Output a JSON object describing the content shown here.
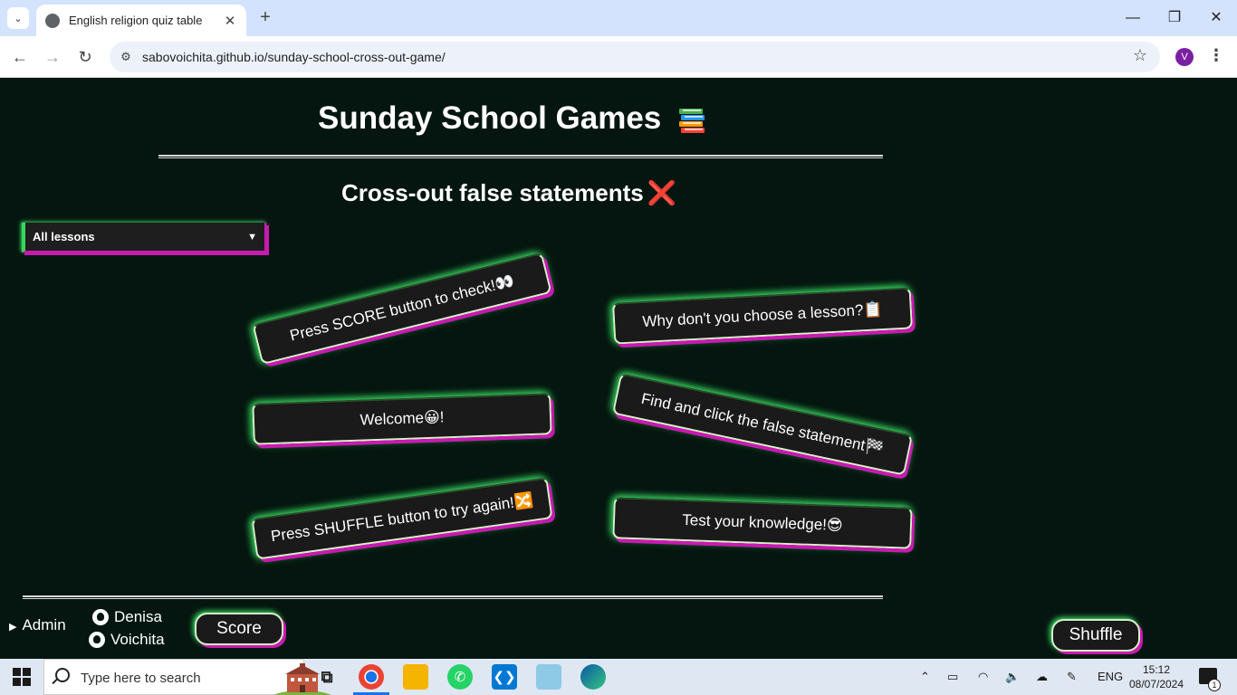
{
  "browser": {
    "tab_title": "English religion quiz table",
    "url": "sabovoichita.github.io/sunday-school-cross-out-game/",
    "profile_initial": "V"
  },
  "page": {
    "title": "Sunday School Games",
    "title_icon": "books-icon",
    "subtitle": "Cross-out false statements",
    "subtitle_icon": "❌",
    "lesson_select": {
      "value": "All lessons"
    },
    "cards": [
      {
        "text": "Press SCORE button to check!👀"
      },
      {
        "text": "Why don't you choose a lesson?📋"
      },
      {
        "text": "Welcome😀!"
      },
      {
        "text": "Find and click the false statement🏁"
      },
      {
        "text": "Press SHUFFLE button to try again!🔀"
      },
      {
        "text": "Test your knowledge!😎"
      }
    ],
    "footer": {
      "admin_label": "Admin",
      "credits": [
        "Denisa",
        "Voichita"
      ],
      "score_label": "Score",
      "shuffle_label": "Shuffle"
    }
  },
  "taskbar": {
    "search_placeholder": "Type here to search",
    "language": "ENG",
    "time": "15:12",
    "date": "08/07/2024",
    "notification_count": "1"
  },
  "colors": {
    "page_bg": "#051610",
    "glow_green": "#37d760",
    "shadow_magenta": "#c71bb0",
    "card_bg": "#1a1a1a"
  }
}
